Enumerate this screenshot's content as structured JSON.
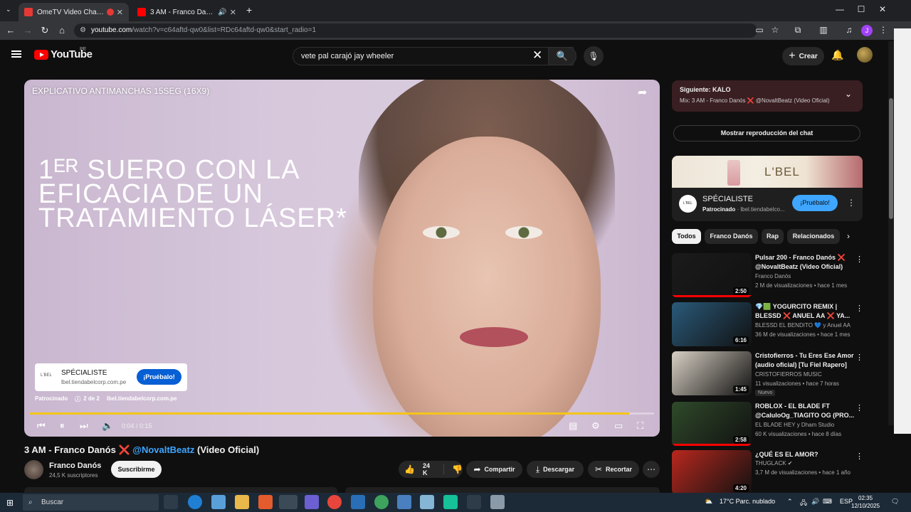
{
  "browser": {
    "tabs": [
      {
        "title": "OmeTV Video Chat — Ome",
        "favicon_color": "#e53935"
      },
      {
        "title": "3 AM - Franco Danós",
        "favicon_color": "#ff0000"
      }
    ],
    "url_domain": "youtube.com",
    "url_rest": "/watch?v=c64aftd-qw0&list=RDc64aftd-qw0&start_radio=1",
    "profile_initial": "J"
  },
  "header": {
    "logo_text": "YouTube",
    "country_code": "PE",
    "search_value": "vete pal carajó jay wheeler",
    "create_label": "Crear"
  },
  "player": {
    "ad_title": "EXPLICATIVO ANTIMANCHAS 15SEG (16X9)",
    "promo_lines": [
      "1ᴱᴿ SUERO CON LA",
      "EFICACIA DE UN",
      "TRATAMIENTO LÁSER*"
    ],
    "ad_card": {
      "logo": "L'BEL",
      "name": "SPÉCIALISTE",
      "domain": "lbel.tiendabelcorp.com.pe",
      "cta": "¡Pruébalo!"
    },
    "ad_meta": {
      "sponsored": "Patrocinado",
      "count": "2 de 2",
      "domain": "lbel.tiendabelcorp.com.pe"
    },
    "time": "0:04 / 0:15",
    "progress": 0.96
  },
  "video": {
    "title_part1": "3 AM - Franco Danós",
    "title_x": "❌",
    "title_mention": "@NovaltBeatz",
    "title_part2": "(Video Oficial)",
    "channel": "Franco Danós",
    "subscribers": "24,5 K suscriptores",
    "subscribe_label": "Suscribirme",
    "likes": "24 K",
    "share_label": "Compartir",
    "download_label": "Descargar",
    "clip_label": "Recortar"
  },
  "sidebar": {
    "next": {
      "label": "Siguiente: KALO",
      "mix_prefix": "Mix: 3 AM - Franco Danós",
      "mix_x": "❌",
      "mix_suffix": "@NovaltBeatz (Video Oficial)"
    },
    "chat_replay": "Mostrar reproducción del chat",
    "ad": {
      "brand": "L'BEL",
      "logo": "L'BEL",
      "name": "SPÉCIALISTE",
      "sponsored": "Patrocinado",
      "domain": "lbel.tiendabelco...",
      "cta": "¡Pruébalo!"
    },
    "chips": [
      "Todos",
      "Franco Danós",
      "Rap",
      "Relacionados"
    ],
    "recommendations": [
      {
        "title": "Pulsar 200 - Franco Danós ❌ @NovaltBeatz (Video Oficial)",
        "channel": "Franco Danós",
        "meta": "2 M de visualizaciones • hace 1 mes",
        "duration": "2:50",
        "progress": 1.0,
        "thumb_color": "#1b1b1b",
        "badge": ""
      },
      {
        "title": "💎🟩 YOGURCITO REMIX | BLESSD ❌ ANUEL AA ❌ YA...",
        "channel": "BLESSD EL BENDITO 💙 y Anuel AA",
        "meta": "36 M de visualizaciones • hace 1 mes",
        "duration": "6:16",
        "progress": 0.0,
        "thumb_color": "#2a5a7a",
        "badge": ""
      },
      {
        "title": "Cristofierros - Tu Eres Ese Amor (audio oficial) [Tu Fiel Rapero]",
        "channel": "CRISTOFIERROS MUSIC",
        "meta": "11 visualizaciones • hace 7 horas",
        "duration": "1:45",
        "progress": 0.0,
        "thumb_color": "#d8d0c4",
        "badge": "Nuevo"
      },
      {
        "title": "ROBLOX - EL BLADE FT @CaluloOg_TIAGITO OG (PRO...",
        "channel": "EL BLADE HEY y Dham Studio",
        "meta": "60 K visualizaciones • hace 8 días",
        "duration": "2:58",
        "progress": 1.0,
        "thumb_color": "#2f4a2a",
        "badge": ""
      },
      {
        "title": "¿QUÉ ES EL AMOR?",
        "channel": "THUGLACK ✔",
        "meta": "3,7 M de visualizaciones • hace 1 año",
        "duration": "4:20",
        "progress": 0.0,
        "thumb_color": "#b8281e",
        "badge": ""
      }
    ]
  },
  "taskbar": {
    "search_label": "Buscar",
    "weather": "17°C  Parc. nublado",
    "language": "ESP",
    "time": "02:35",
    "date": "12/10/2025"
  }
}
